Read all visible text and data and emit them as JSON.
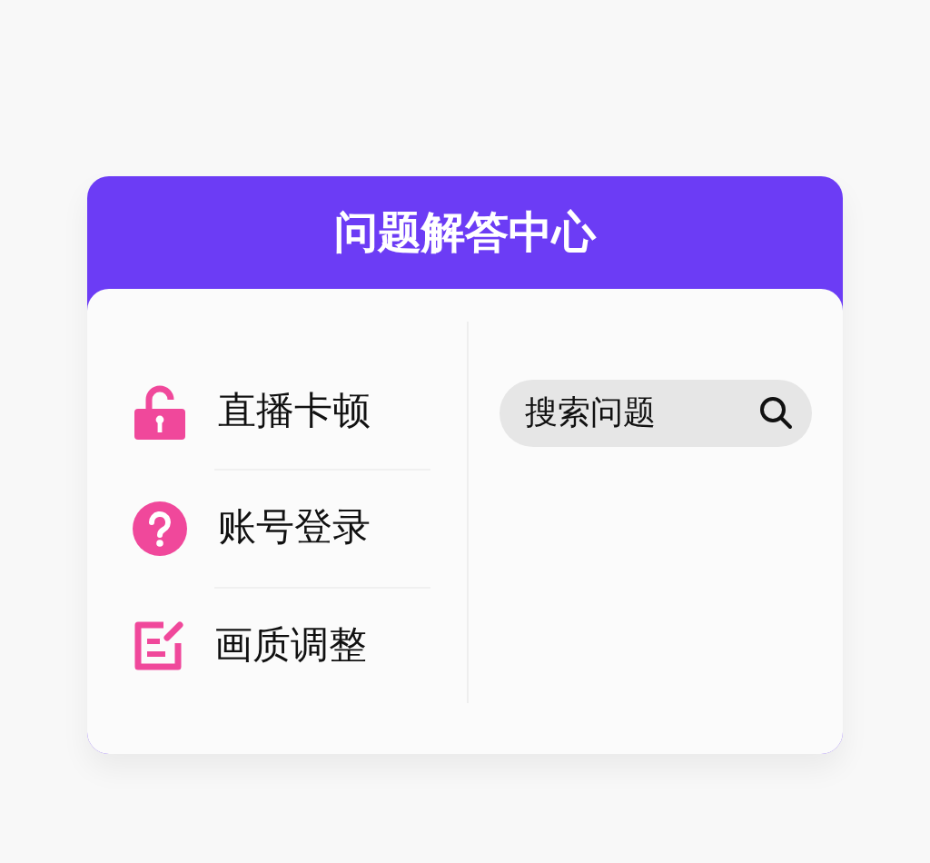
{
  "header": {
    "title": "问题解答中心"
  },
  "menu": [
    {
      "label": "直播卡顿"
    },
    {
      "label": "账号登录"
    },
    {
      "label": "画质调整"
    }
  ],
  "search": {
    "placeholder": "搜索问题"
  }
}
